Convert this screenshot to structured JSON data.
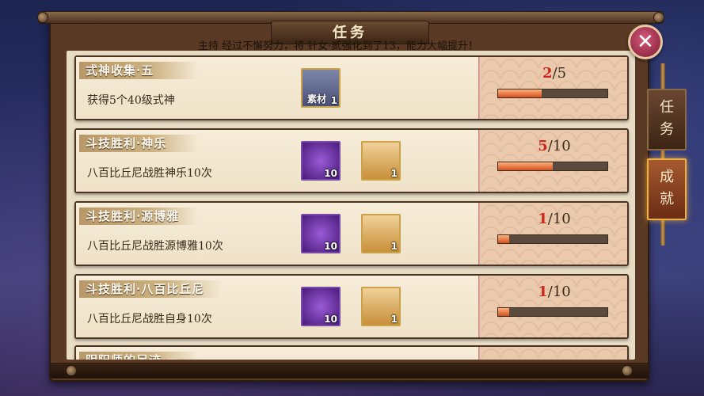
{
  "header": {
    "title": "任务",
    "marquee": "主持 经过不懈努力，将 针女·贰强化到了13，能力大幅提升！"
  },
  "side_tabs": [
    {
      "label": "任\n务",
      "active": false
    },
    {
      "label": "成\n就",
      "active": true
    }
  ],
  "close_icon": "close-icon",
  "tasks": [
    {
      "title": "式神收集·五",
      "desc": "获得5个40级式神",
      "rewards": [
        {
          "icon": "material-doll-icon",
          "tag": "素材",
          "count": "1"
        }
      ],
      "progress": {
        "current": "2",
        "total": "/5",
        "fraction": 0.4
      }
    },
    {
      "title": "斗技胜利·神乐",
      "desc": "八百比丘尼战胜神乐10次",
      "rewards": [
        {
          "icon": "red-gift-icon",
          "count": "10"
        },
        {
          "icon": "character-card-icon",
          "count": "1"
        }
      ],
      "progress": {
        "current": "5",
        "total": "/10",
        "fraction": 0.5
      }
    },
    {
      "title": "斗技胜利·源博雅",
      "desc": "八百比丘尼战胜源博雅10次",
      "rewards": [
        {
          "icon": "red-gift-icon",
          "count": "10"
        },
        {
          "icon": "character-card-icon",
          "count": "1"
        }
      ],
      "progress": {
        "current": "1",
        "total": "/10",
        "fraction": 0.1
      }
    },
    {
      "title": "斗技胜利·八百比丘尼",
      "desc": "八百比丘尼战胜自身10次",
      "rewards": [
        {
          "icon": "red-gift-icon",
          "count": "10"
        },
        {
          "icon": "character-card-icon",
          "count": "1"
        }
      ],
      "progress": {
        "current": "1",
        "total": "/10",
        "fraction": 0.1
      }
    },
    {
      "title": "阴阳师的足迹·一"
    }
  ]
}
